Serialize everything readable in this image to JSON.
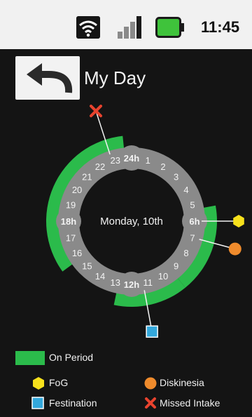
{
  "status_bar": {
    "time": "11:45"
  },
  "header": {
    "title": "My Day"
  },
  "clock": {
    "center_label": "Monday, 10th",
    "hour_labels": [
      "24h",
      "1",
      "2",
      "3",
      "4",
      "5",
      "6h",
      "7",
      "8",
      "9",
      "10",
      "11",
      "12h",
      "13",
      "14",
      "15",
      "16",
      "17",
      "18h",
      "19",
      "20",
      "21",
      "22",
      "23"
    ],
    "on_periods": [
      {
        "start_hour": 5.3,
        "end_hour": 9.4
      },
      {
        "start_hour": 9.4,
        "end_hour": 12.8
      },
      {
        "start_hour": 15.6,
        "end_hour": 23.6
      }
    ],
    "events": [
      {
        "type": "missed-intake",
        "hour": 22.8
      },
      {
        "type": "fog",
        "hour": 6.0
      },
      {
        "type": "diskinesia",
        "hour": 7.0
      },
      {
        "type": "festination",
        "hour": 11.3
      }
    ]
  },
  "colors": {
    "on_period": "#2bbb4b",
    "ring": "#8a8a8a",
    "fog": "#f7e11c",
    "diskinesia": "#ef8b2c",
    "festination": "#33a8dc",
    "missed_intake": "#e8432e"
  },
  "legend": {
    "on_period": "On Period",
    "fog": "FoG",
    "diskinesia": "Diskinesia",
    "festination": "Festination",
    "missed_intake": "Missed Intake"
  }
}
